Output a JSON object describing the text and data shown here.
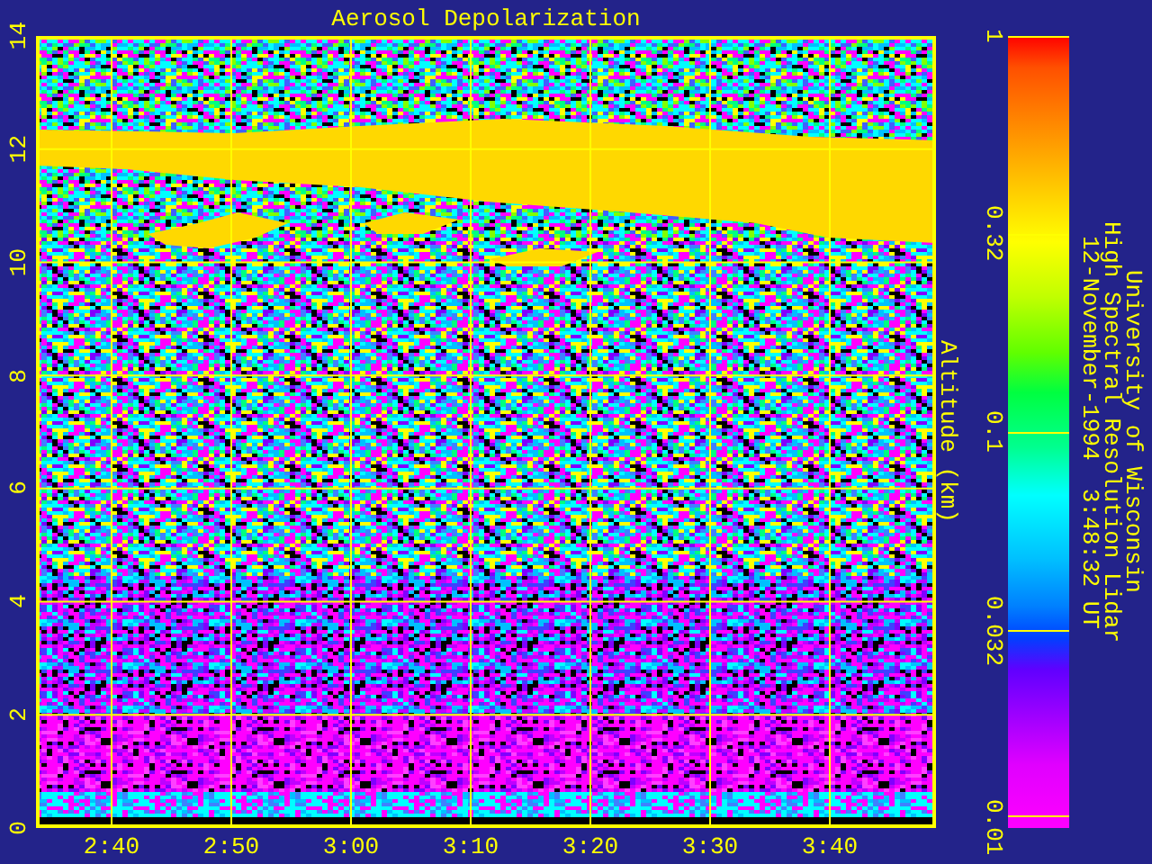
{
  "title": "Aerosol Depolarization",
  "y_axis": {
    "label": "Altitude (km)",
    "ticks": [
      "0",
      "2",
      "4",
      "6",
      "8",
      "10",
      "12",
      "14"
    ]
  },
  "x_axis": {
    "ticks": [
      "2:40",
      "2:50",
      "3:00",
      "3:10",
      "3:20",
      "3:30",
      "3:40"
    ]
  },
  "colorbar": {
    "ticks": [
      "1",
      "0.32",
      "0.1",
      "0.032",
      "0.01"
    ]
  },
  "caption": [
    "University of Wisconsin",
    "High Spectral Resolution Lidar",
    "12-November-1994  3:48:32 UT"
  ]
}
